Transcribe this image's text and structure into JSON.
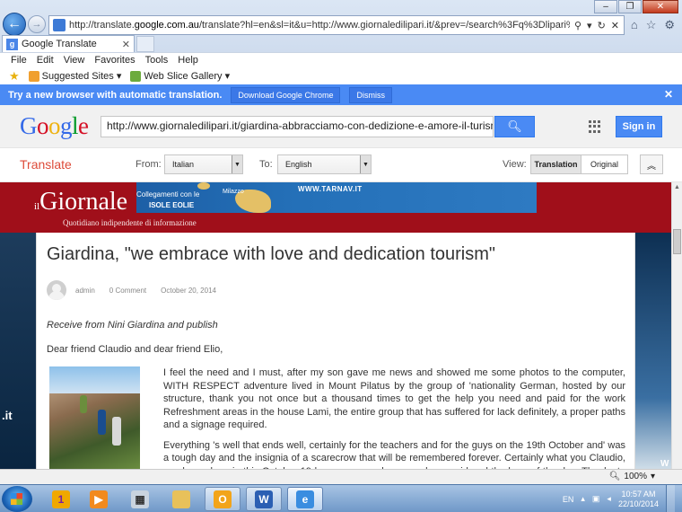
{
  "browser": {
    "url_prefix": "http://translate.",
    "url_host": "google.com.au",
    "url_rest": "/translate?hl=en&sl=it&u=http://www.giornaledilipari.it/&prev=/search%3Fq%3Dlipari%2Bnews%26rls%3Dcom.m",
    "tab_title": "Google Translate",
    "menu": [
      "File",
      "Edit",
      "View",
      "Favorites",
      "Tools",
      "Help"
    ],
    "favorites": [
      "Suggested Sites ▾",
      "Web Slice Gallery ▾"
    ],
    "zoom": "100%"
  },
  "promo": {
    "text": "Try a new browser with automatic translation.",
    "download_label": "Download Google Chrome",
    "dismiss_label": "Dismiss"
  },
  "google": {
    "logo_letters": [
      "G",
      "o",
      "o",
      "g",
      "l",
      "e"
    ],
    "search_value": "http://www.giornaledilipari.it/giardina-abbracciamo-con-dedizione-e-amore-il-turismo",
    "sign_in_label": "Sign in"
  },
  "translate": {
    "title": "Translate",
    "from_label": "From:",
    "from_value": "Italian",
    "to_label": "To:",
    "to_value": "English",
    "view_label": "View:",
    "view_translation": "Translation",
    "view_original": "Original"
  },
  "site": {
    "logo_prefix": "il",
    "logo_name": "Giornale",
    "tagline": "Quotidiano indipendente di informazione",
    "ad_line1": "Collegamenti con le",
    "ad_line2": "ISOLE EOLIE",
    "ad_place": "Milazzo",
    "ad_site": "WWW.TARNAV.IT",
    "side_left_text": ".it",
    "side_right_text": "W"
  },
  "article": {
    "title": "Giardina, \"we embrace with love and dedication tourism\"",
    "author": "admin",
    "comments": "0 Comment",
    "date": "October 20, 2014",
    "receive": "Receive from Nini Giardina and publish",
    "greeting": "Dear friend Claudio and dear friend Elio,",
    "paragraph1": "I feel the need and I must, after my son gave me news and showed me some photos to the computer, WITH RESPECT adventure lived in Mount Pilatus by the group of 'nationality German, hosted by our structure, thank you not once but a thousand times to get the help you need and paid for the work Refreshment areas in the house Lami, the entire group that has suffered for lack definitely, a proper paths and a signage required.",
    "paragraph2": "Everything 's well that ends well, certainly for the teachers and for the guys on the 19th October and' was a tough day and the insignia of a scarecrow that will be remembered forever. Certainly what you Claudio, you have done in this October 19 honors you and you can be considered the hero of the day; Thanks to you,"
  },
  "taskbar": {
    "language": "EN",
    "time": "10:57 AM",
    "date": "22/10/2014"
  }
}
